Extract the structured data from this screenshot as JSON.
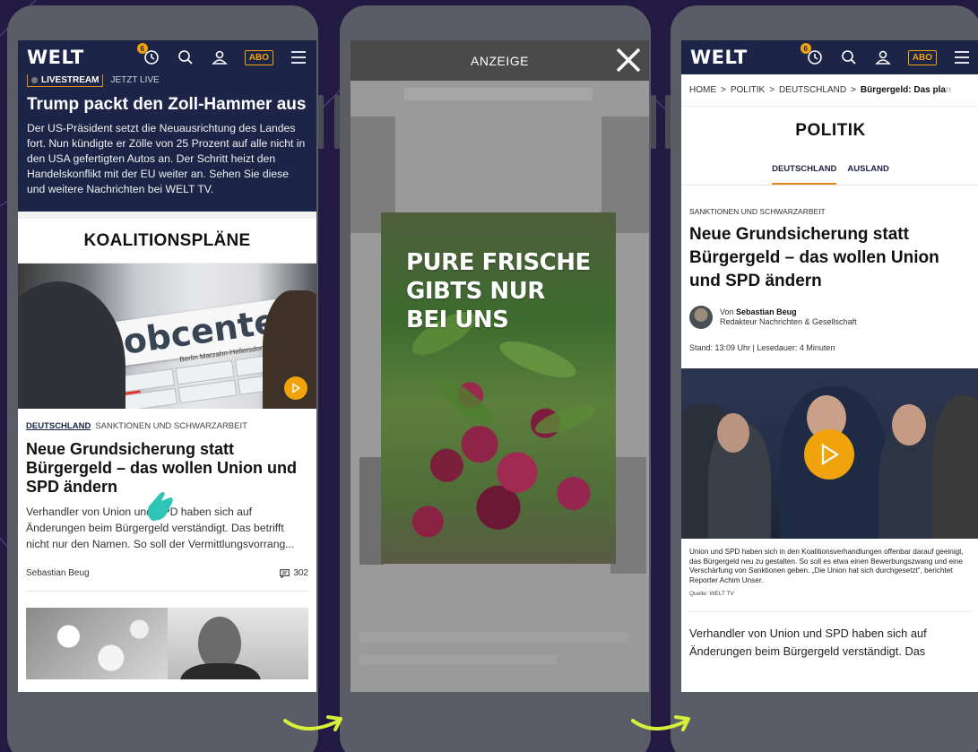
{
  "colors": {
    "accent": "#f0a30a",
    "navy": "#1c2547",
    "background": "#221a42"
  },
  "screen1": {
    "logo": "WELT",
    "notification_count": "6",
    "abo_label": "ABO",
    "live": {
      "tag": "LIVESTREAM",
      "status": "JETZT LIVE",
      "title": "Trump packt den Zoll-Hammer aus",
      "text": "Der US-Präsident setzt die Neuausrichtung des Landes fort. Nun kündigte er Zölle von 25 Prozent auf alle nicht in den USA gefertigten Autos an. Der Schritt heizt den Handelskonflikt mit der EU weiter an. Sehen Sie diese und weitere Nachrichten bei WELT TV."
    },
    "section_title": "KOALITIONSPLÄNE",
    "image_sign": "jobcenter",
    "image_subtext": "Berlin Marzahn-Hellersdorf",
    "article": {
      "category_primary": "DEUTSCHLAND",
      "category_secondary": "SANKTIONEN UND SCHWARZARBEIT",
      "title": "Neue Grundsicherung statt Bürgergeld – das wollen Union und SPD ändern",
      "text": "Verhandler von Union und SPD haben sich auf Änderungen beim Bürgergeld verständigt. Das betrifft nicht nur den Namen. So soll der Vermittlungsvorrang...",
      "author": "Sebastian Beug",
      "comments": "302"
    }
  },
  "screen2": {
    "header": "ANZEIGE",
    "ad_line1": "PURE FRISCHE",
    "ad_line2": "GIBTS NUR",
    "ad_line3": "BEI UNS"
  },
  "screen3": {
    "logo": "WELT",
    "notification_count": "6",
    "abo_label": "ABO",
    "breadcrumb": {
      "home": "HOME",
      "politik": "POLITIK",
      "deutschland": "DEUTSCHLAND",
      "current": "Bürgergeld: Das pla",
      "current_fade": "n"
    },
    "section_title": "POLITIK",
    "tabs": [
      "DEUTSCHLAND",
      "AUSLAND"
    ],
    "kicker": "SANKTIONEN UND SCHWARZARBEIT",
    "title": "Neue Grundsicherung statt Bürgergeld – das wollen Union und SPD ändern",
    "author_prefix": "Von",
    "author_name": "Sebastian Beug",
    "author_role": "Redakteur Nachrichten & Gesellschaft",
    "stand": "Stand: 13:09 Uhr | Lesedauer: 4 Minuten",
    "caption": "Union und SPD haben sich in den Koalitionsverhandlungen offenbar darauf geeinigt, das Bürgergeld neu zu gestalten. So soll es etwa einen Bewerbungszwang und eine Verschärfung von Sanktionen geben. „Die Union hat sich durchgesetzt“, berichtet Reporter Achim Unser.",
    "quelle": "Quelle: WELT TV",
    "body": "Verhandler von Union und SPD haben sich auf Änderungen beim Bürgergeld verständigt. Das"
  }
}
